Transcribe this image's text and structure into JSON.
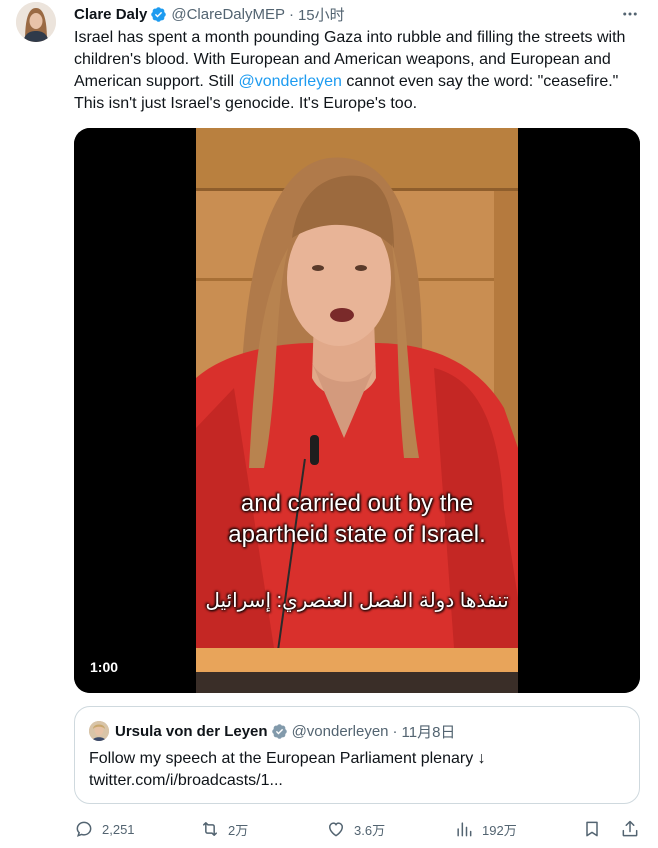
{
  "tweet": {
    "author_name": "Clare Daly",
    "handle": "@ClareDalyMEP",
    "separator": "·",
    "time": "15小时",
    "more_icon": "more-icon",
    "text_part1": "Israel has spent a month pounding Gaza into rubble and filling the streets with children's blood. With European and American weapons, and European and American support. Still ",
    "mention": "@vonderleyen",
    "text_part2": " cannot even say the word: \"ceasefire.\" This isn't just Israel's genocide. It's Europe's too."
  },
  "video": {
    "caption_en": "and carried out by the apartheid state of Israel.",
    "caption_ar": "تنفذها دولة الفصل العنصري: إسرائيل",
    "duration": "1:00"
  },
  "quoted_tweet": {
    "author_name": "Ursula von der Leyen",
    "handle": "@vonderleyen",
    "separator": "·",
    "date": "11月8日",
    "text": "Follow my speech at the European Parliament plenary ↓",
    "link": "twitter.com/i/broadcasts/1..."
  },
  "actions": {
    "replies": "2,251",
    "retweets": "2万",
    "likes": "3.6万",
    "views": "192万"
  },
  "colors": {
    "accent": "#1d9bf0",
    "secondary_text": "#536471",
    "border": "#cfd9de",
    "primary_text": "#0f1419"
  }
}
